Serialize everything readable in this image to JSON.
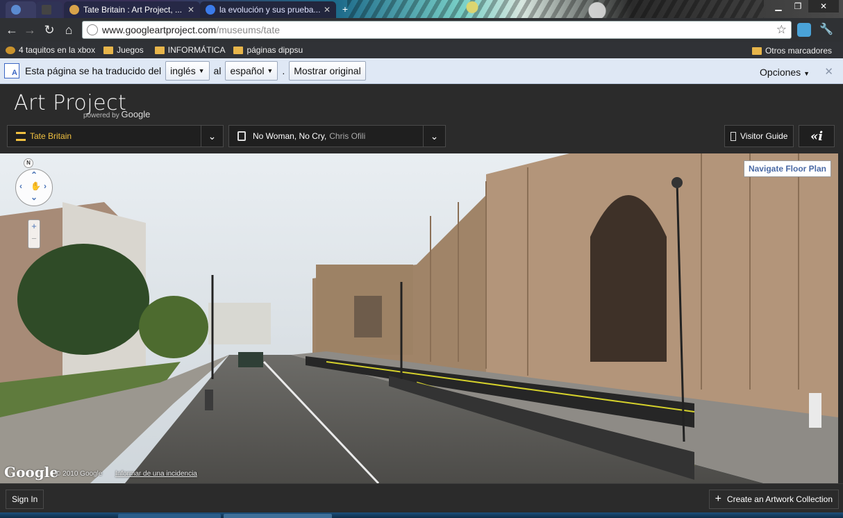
{
  "browser": {
    "tabs": [
      {
        "title": "Tate Britain : Art Project, ...",
        "active": true
      },
      {
        "title": "la evolución y sus prueba...",
        "active": false
      }
    ],
    "url_host": "www.googleartproject.com",
    "url_path": "/museums/tate",
    "bookmarks": [
      "4 taquitos en la xbox",
      "Juegos",
      "INFORMÁTICA",
      "páginas dippsu"
    ],
    "bookmarks_other": "Otros marcadores"
  },
  "translate_bar": {
    "prefix": "Esta página se ha traducido del",
    "from_lang": "inglés",
    "connector": "al",
    "to_lang": "español",
    "period": ".",
    "show_original": "Mostrar original",
    "options": "Opciones"
  },
  "app": {
    "logo": "Art Project",
    "powered_prefix": "powered by",
    "powered_brand": "Google",
    "museum": "Tate Britain",
    "artwork_title": "No Woman, No Cry,",
    "artwork_artist": "Chris Ofili",
    "visitor_guide": "Visitor Guide",
    "info_label": "«i"
  },
  "streetview": {
    "navigate_floor_plan": "Navigate Floor Plan",
    "compass": "N",
    "google_logo": "Google",
    "copyright": "© 2010 Google",
    "report": "Informar de una incidencia"
  },
  "footer": {
    "sign_in": "Sign In",
    "create_collection": "Create an Artwork Collection"
  },
  "colors": {
    "accent": "#f0c040",
    "header_bg": "#2b2b2b",
    "translate_bg": "#dfe8f5",
    "link_blue": "#4a6aa5"
  }
}
